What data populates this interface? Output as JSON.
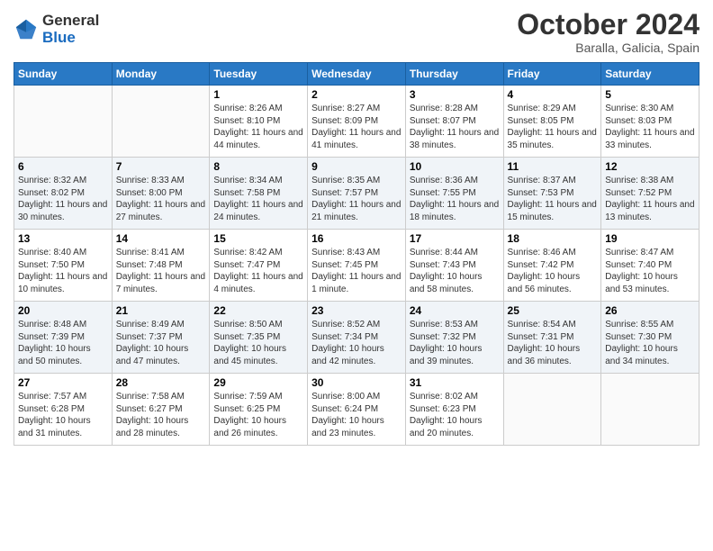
{
  "header": {
    "logo": {
      "general": "General",
      "blue": "Blue"
    },
    "title": "October 2024",
    "location": "Baralla, Galicia, Spain"
  },
  "weekdays": [
    "Sunday",
    "Monday",
    "Tuesday",
    "Wednesday",
    "Thursday",
    "Friday",
    "Saturday"
  ],
  "weeks": [
    [
      {
        "day": "",
        "info": ""
      },
      {
        "day": "",
        "info": ""
      },
      {
        "day": "1",
        "info": "Sunrise: 8:26 AM\nSunset: 8:10 PM\nDaylight: 11 hours and 44 minutes."
      },
      {
        "day": "2",
        "info": "Sunrise: 8:27 AM\nSunset: 8:09 PM\nDaylight: 11 hours and 41 minutes."
      },
      {
        "day": "3",
        "info": "Sunrise: 8:28 AM\nSunset: 8:07 PM\nDaylight: 11 hours and 38 minutes."
      },
      {
        "day": "4",
        "info": "Sunrise: 8:29 AM\nSunset: 8:05 PM\nDaylight: 11 hours and 35 minutes."
      },
      {
        "day": "5",
        "info": "Sunrise: 8:30 AM\nSunset: 8:03 PM\nDaylight: 11 hours and 33 minutes."
      }
    ],
    [
      {
        "day": "6",
        "info": "Sunrise: 8:32 AM\nSunset: 8:02 PM\nDaylight: 11 hours and 30 minutes."
      },
      {
        "day": "7",
        "info": "Sunrise: 8:33 AM\nSunset: 8:00 PM\nDaylight: 11 hours and 27 minutes."
      },
      {
        "day": "8",
        "info": "Sunrise: 8:34 AM\nSunset: 7:58 PM\nDaylight: 11 hours and 24 minutes."
      },
      {
        "day": "9",
        "info": "Sunrise: 8:35 AM\nSunset: 7:57 PM\nDaylight: 11 hours and 21 minutes."
      },
      {
        "day": "10",
        "info": "Sunrise: 8:36 AM\nSunset: 7:55 PM\nDaylight: 11 hours and 18 minutes."
      },
      {
        "day": "11",
        "info": "Sunrise: 8:37 AM\nSunset: 7:53 PM\nDaylight: 11 hours and 15 minutes."
      },
      {
        "day": "12",
        "info": "Sunrise: 8:38 AM\nSunset: 7:52 PM\nDaylight: 11 hours and 13 minutes."
      }
    ],
    [
      {
        "day": "13",
        "info": "Sunrise: 8:40 AM\nSunset: 7:50 PM\nDaylight: 11 hours and 10 minutes."
      },
      {
        "day": "14",
        "info": "Sunrise: 8:41 AM\nSunset: 7:48 PM\nDaylight: 11 hours and 7 minutes."
      },
      {
        "day": "15",
        "info": "Sunrise: 8:42 AM\nSunset: 7:47 PM\nDaylight: 11 hours and 4 minutes."
      },
      {
        "day": "16",
        "info": "Sunrise: 8:43 AM\nSunset: 7:45 PM\nDaylight: 11 hours and 1 minute."
      },
      {
        "day": "17",
        "info": "Sunrise: 8:44 AM\nSunset: 7:43 PM\nDaylight: 10 hours and 58 minutes."
      },
      {
        "day": "18",
        "info": "Sunrise: 8:46 AM\nSunset: 7:42 PM\nDaylight: 10 hours and 56 minutes."
      },
      {
        "day": "19",
        "info": "Sunrise: 8:47 AM\nSunset: 7:40 PM\nDaylight: 10 hours and 53 minutes."
      }
    ],
    [
      {
        "day": "20",
        "info": "Sunrise: 8:48 AM\nSunset: 7:39 PM\nDaylight: 10 hours and 50 minutes."
      },
      {
        "day": "21",
        "info": "Sunrise: 8:49 AM\nSunset: 7:37 PM\nDaylight: 10 hours and 47 minutes."
      },
      {
        "day": "22",
        "info": "Sunrise: 8:50 AM\nSunset: 7:35 PM\nDaylight: 10 hours and 45 minutes."
      },
      {
        "day": "23",
        "info": "Sunrise: 8:52 AM\nSunset: 7:34 PM\nDaylight: 10 hours and 42 minutes."
      },
      {
        "day": "24",
        "info": "Sunrise: 8:53 AM\nSunset: 7:32 PM\nDaylight: 10 hours and 39 minutes."
      },
      {
        "day": "25",
        "info": "Sunrise: 8:54 AM\nSunset: 7:31 PM\nDaylight: 10 hours and 36 minutes."
      },
      {
        "day": "26",
        "info": "Sunrise: 8:55 AM\nSunset: 7:30 PM\nDaylight: 10 hours and 34 minutes."
      }
    ],
    [
      {
        "day": "27",
        "info": "Sunrise: 7:57 AM\nSunset: 6:28 PM\nDaylight: 10 hours and 31 minutes."
      },
      {
        "day": "28",
        "info": "Sunrise: 7:58 AM\nSunset: 6:27 PM\nDaylight: 10 hours and 28 minutes."
      },
      {
        "day": "29",
        "info": "Sunrise: 7:59 AM\nSunset: 6:25 PM\nDaylight: 10 hours and 26 minutes."
      },
      {
        "day": "30",
        "info": "Sunrise: 8:00 AM\nSunset: 6:24 PM\nDaylight: 10 hours and 23 minutes."
      },
      {
        "day": "31",
        "info": "Sunrise: 8:02 AM\nSunset: 6:23 PM\nDaylight: 10 hours and 20 minutes."
      },
      {
        "day": "",
        "info": ""
      },
      {
        "day": "",
        "info": ""
      }
    ]
  ]
}
